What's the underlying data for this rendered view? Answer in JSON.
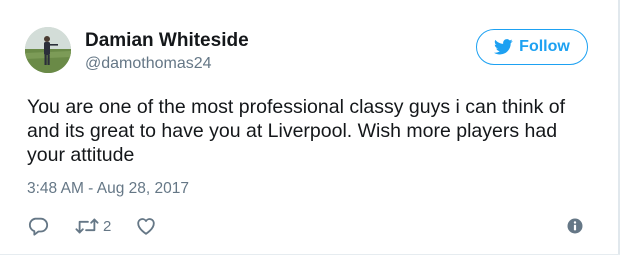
{
  "user": {
    "display_name": "Damian Whiteside",
    "handle": "@damothomas24",
    "avatar_icon": "profile-photo"
  },
  "follow_button": {
    "label": "Follow",
    "icon": "twitter-bird-icon",
    "color": "#1da1f2"
  },
  "tweet": {
    "text_lines": [
      "You are one of the most professional classy guys i can think of",
      "and its great to have you at Liverpool. Wish more players had",
      "your attitude"
    ],
    "timestamp": "3:48 AM - Aug 28, 2017"
  },
  "actions": {
    "reply_icon": "reply-icon",
    "retweet_icon": "retweet-icon",
    "retweet_count": "2",
    "like_icon": "heart-icon",
    "info_icon": "info-icon"
  },
  "colors": {
    "text": "#14171a",
    "secondary": "#657786",
    "accent": "#1da1f2",
    "icon_gray": "#657786"
  }
}
